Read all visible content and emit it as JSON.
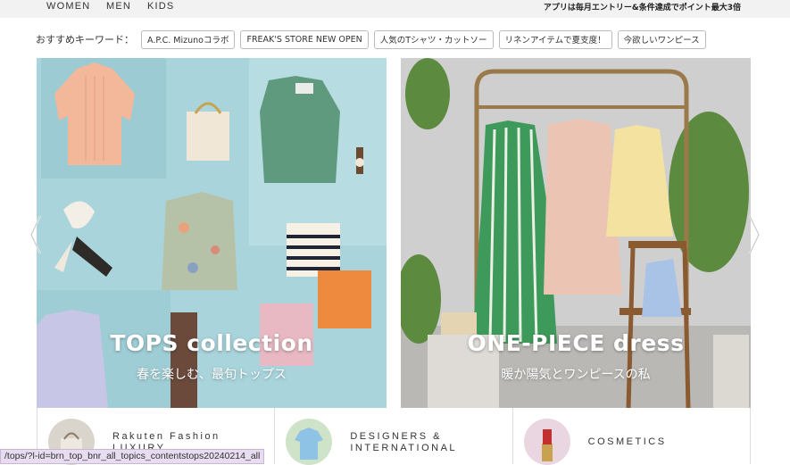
{
  "nav": {
    "categories": [
      "WOMEN",
      "MEN",
      "KIDS"
    ],
    "promo": "アプリは毎月エントリー&条件達成でポイント最大3倍"
  },
  "keywords": {
    "label": "おすすめキーワード：",
    "items": [
      "A.P.C. Mizunoコラボ",
      "FREAK'S STORE NEW OPEN",
      "人気のTシャツ・カットソー",
      "リネンアイテムで夏支度！",
      "今欲しいワンピース"
    ]
  },
  "banners": [
    {
      "title": "TOPS collection",
      "subtitle": "春を楽しむ、最旬トップス"
    },
    {
      "title": "ONE-PIECE dress",
      "subtitle": "暖か陽気とワンピースの私"
    }
  ],
  "carousel": {
    "prev_icon": "chevron-left-icon",
    "next_icon": "chevron-right-icon"
  },
  "cards": [
    {
      "title": "Rakuten Fashion",
      "title2": "LUXURY",
      "icon": "handbag-icon"
    },
    {
      "title": "DESIGNERS &",
      "title2": "INTERNATIONAL",
      "icon": "shirt-icon"
    },
    {
      "title": "COSMETICS",
      "title2": "",
      "icon": "lipstick-icon"
    }
  ],
  "status_url": "/tops/?l-id=brn_top_bnr_all_topics_contentstops20240214_all",
  "colors": {
    "tops_bg": "#a9d4dc",
    "onepiece_bg": "#cfcfcf",
    "status_bg": "#e8dcf0"
  }
}
